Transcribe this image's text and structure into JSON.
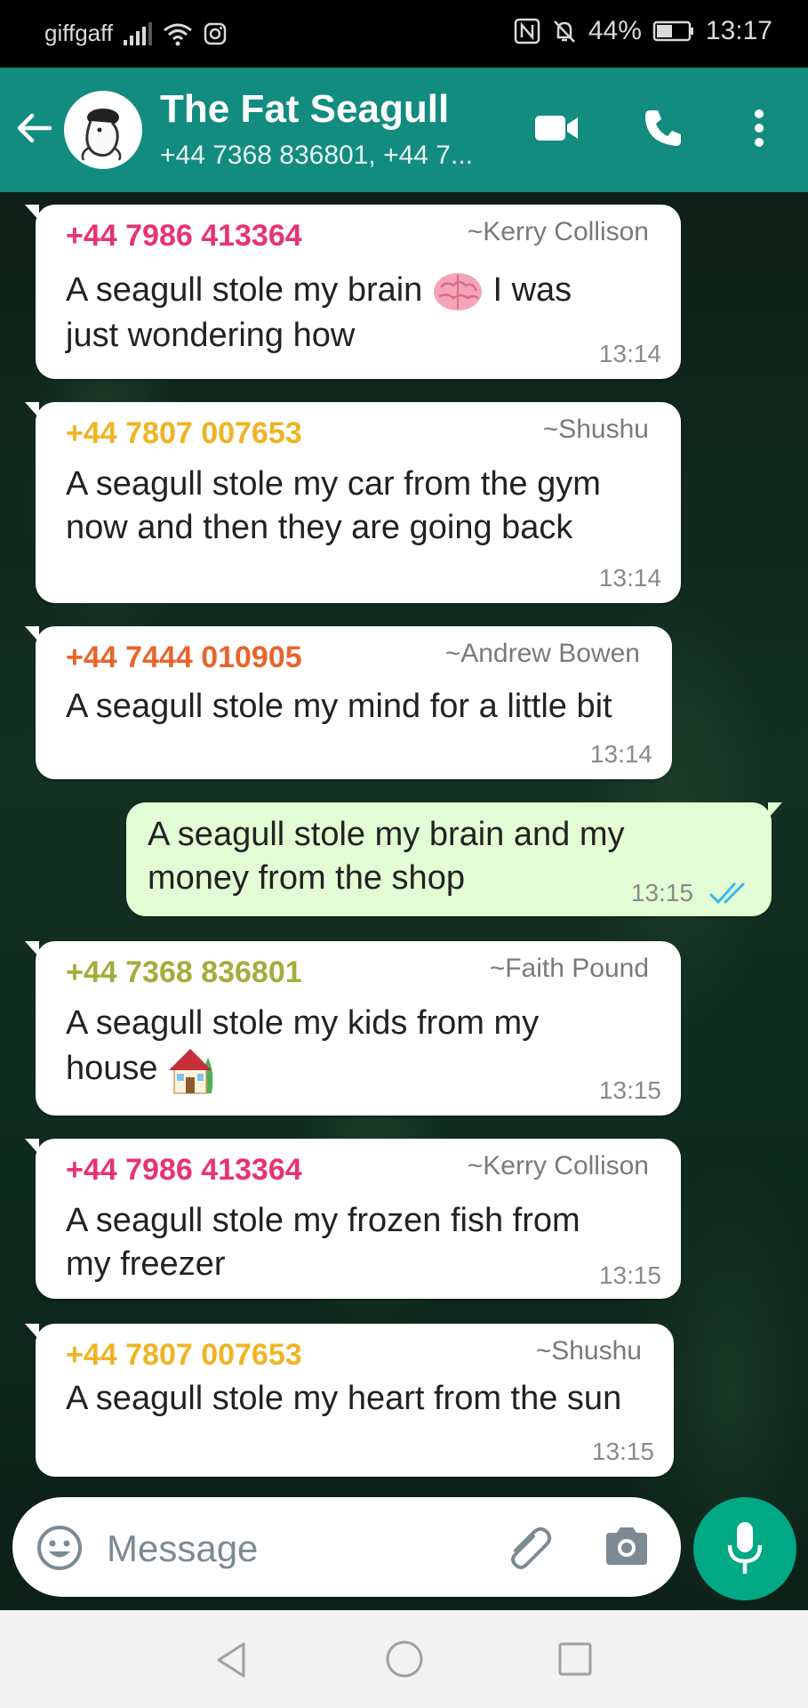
{
  "status_bar": {
    "carrier": "giffgaff",
    "battery": "44%",
    "time": "13:17"
  },
  "header": {
    "title": "The Fat Seagull",
    "subtitle": "+44 7368 836801, +44 7..."
  },
  "messages": [
    {
      "sender": "+44 7986 413364",
      "alias": "~Kerry Collison",
      "line1": "A seagull stole my brain",
      "line1b": "I was",
      "line2": "just wondering how",
      "time": "13:14",
      "color": "#e8336f"
    },
    {
      "sender": "+44 7807 007653",
      "alias": "~Shushu",
      "line1": "A seagull stole my car from the gym",
      "line2": "now and then they are going back",
      "time": "13:14",
      "color": "#f0b323"
    },
    {
      "sender": "+44 7444 010905",
      "alias": "~Andrew Bowen",
      "line1": "A seagull stole my mind for a little bit",
      "time": "13:14",
      "color": "#e8642c"
    },
    {
      "outgoing": true,
      "line1": "A seagull stole my brain and my",
      "line2": "money from the shop",
      "time": "13:15"
    },
    {
      "sender": "+44 7368 836801",
      "alias": "~Faith Pound",
      "line1": "A seagull stole my kids from my",
      "line2": "house",
      "time": "13:15",
      "color": "#a4ad3c"
    },
    {
      "sender": "+44 7986 413364",
      "alias": "~Kerry Collison",
      "line1": "A seagull stole my frozen fish from",
      "line2": "my freezer",
      "time": "13:15",
      "color": "#e8336f"
    },
    {
      "sender": "+44 7807 007653",
      "alias": "~Shushu",
      "line1": "A seagull stole my heart from the sun",
      "time": "13:15",
      "color": "#f0b323"
    }
  ],
  "input": {
    "placeholder": "Message"
  },
  "icons": [
    "back-arrow-icon",
    "video-call-icon",
    "phone-icon",
    "more-options-icon",
    "emoji-icon",
    "attach-icon",
    "camera-icon",
    "microphone-icon",
    "brain-emoji",
    "house-emoji",
    "double-check-icon"
  ],
  "colors": {
    "header": "#128c7e",
    "accent": "#00a884",
    "outgoing_bubble": "#e2fdd3",
    "read_ticks": "#34b7f1"
  }
}
